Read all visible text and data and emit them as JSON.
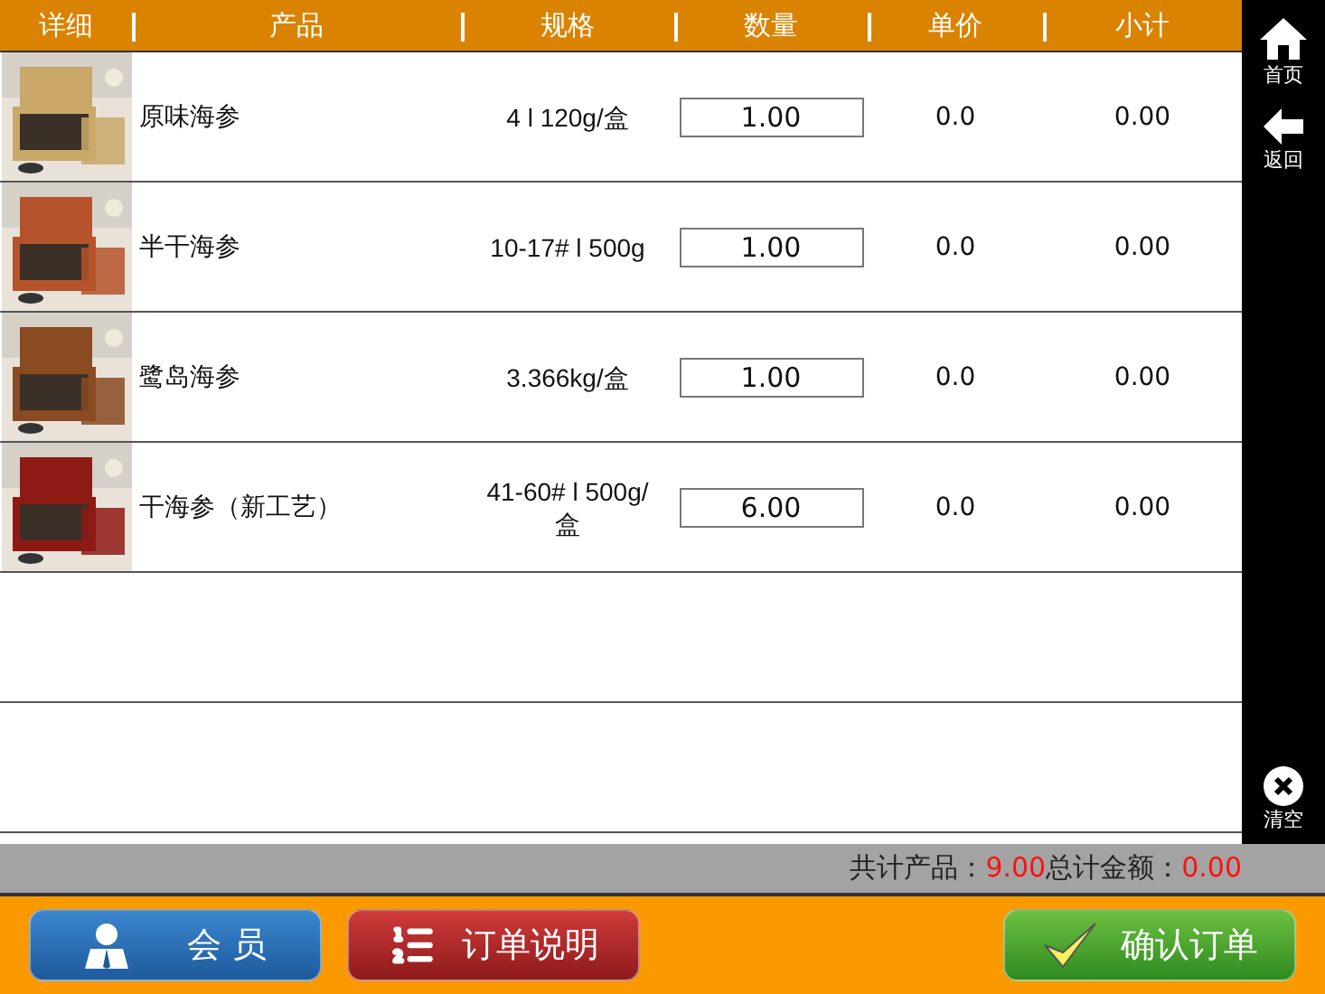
{
  "table": {
    "columns": [
      "详细",
      "产品",
      "规格",
      "数量",
      "单价",
      "小计"
    ],
    "rows": [
      {
        "product": "原味海参",
        "spec": "4 l 120g/盒",
        "quantity": "1.00",
        "price": "0.0",
        "subtotal": "0.00"
      },
      {
        "product": "半干海参",
        "spec": "10-17# l 500g",
        "quantity": "1.00",
        "price": "0.0",
        "subtotal": "0.00"
      },
      {
        "product": "鹭岛海参",
        "spec": "3.366kg/盒",
        "quantity": "1.00",
        "price": "0.0",
        "subtotal": "0.00"
      },
      {
        "product": "干海参（新工艺）",
        "spec": "41-60# l 500g/盒",
        "quantity": "6.00",
        "price": "0.0",
        "subtotal": "0.00"
      }
    ]
  },
  "sidebar": {
    "items": [
      {
        "label": "首页",
        "kind": "home"
      },
      {
        "label": "返回",
        "kind": "back"
      }
    ],
    "bottom": {
      "label": "清空",
      "kind": "clear"
    }
  },
  "summary": {
    "products_label": "共计产品：",
    "products_value": "9.00",
    "amount_label": "总计金额：",
    "amount_value": "0.00"
  },
  "buttons": [
    {
      "label": "会 员",
      "kind": "member"
    },
    {
      "label": "订单说明",
      "kind": "notes"
    },
    {
      "label": "确认订单",
      "kind": "confirm"
    }
  ]
}
